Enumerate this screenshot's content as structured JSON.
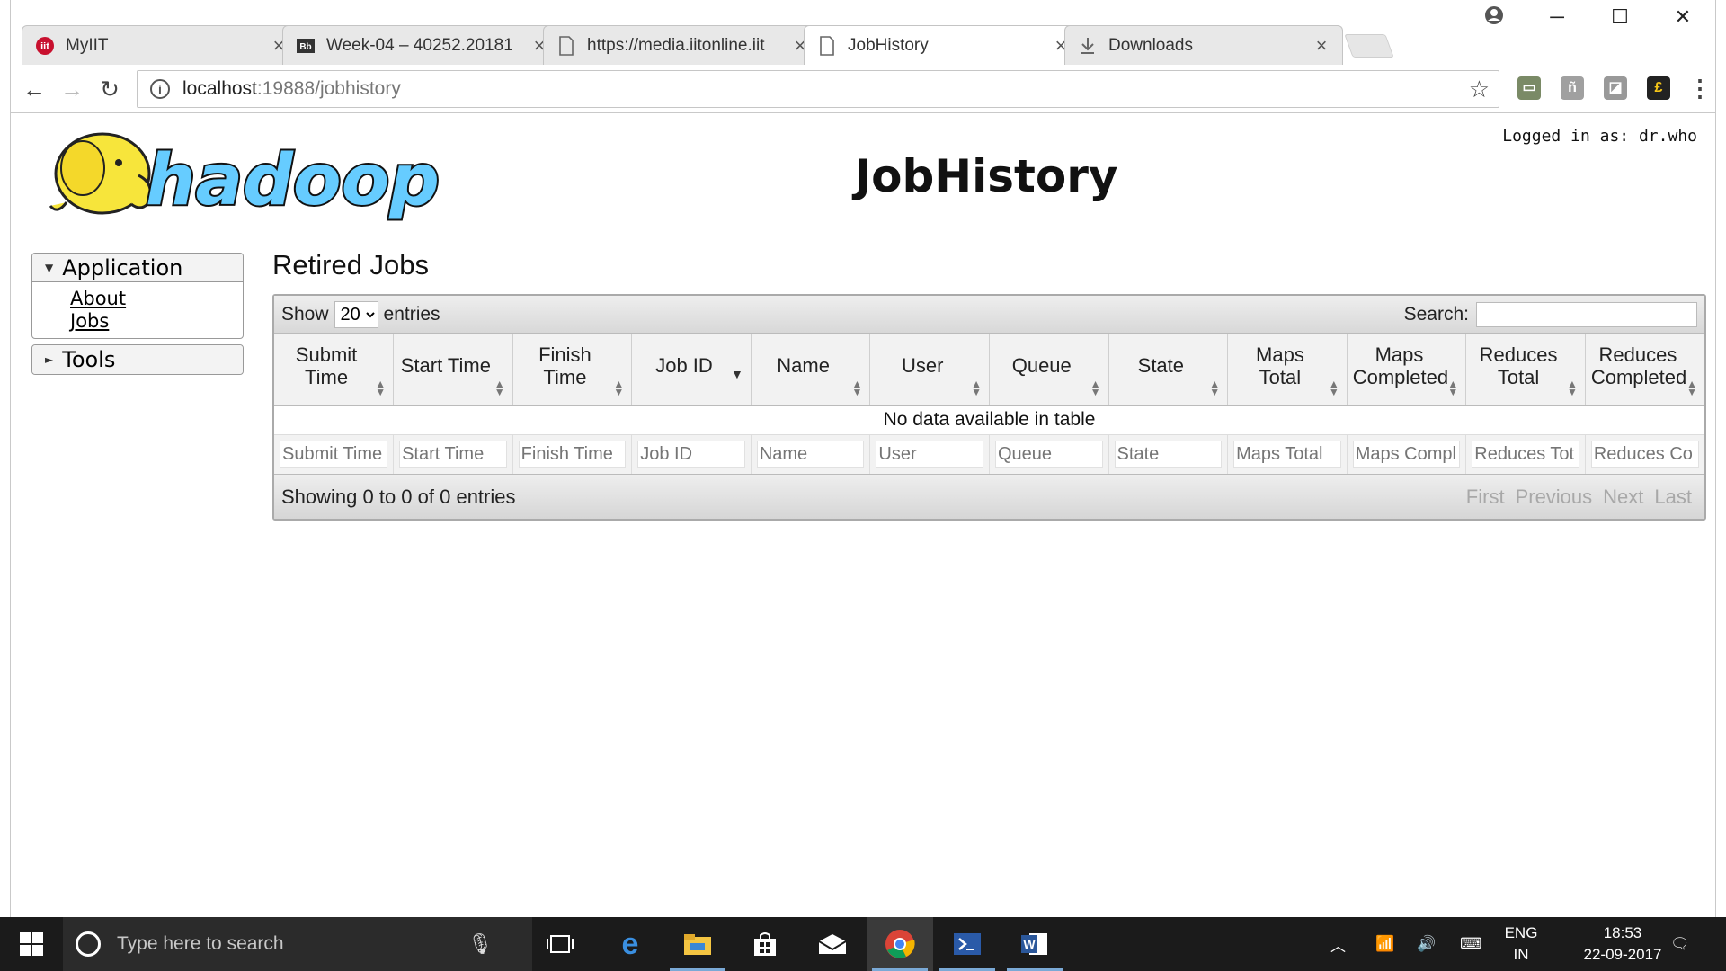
{
  "browser": {
    "tabs": [
      {
        "label": "MyIIT",
        "icon": "iit-favicon"
      },
      {
        "label": "Week-04 – 40252.20181",
        "icon": "blackboard-favicon"
      },
      {
        "label": "https://media.iitonline.iit",
        "icon": "page-icon"
      },
      {
        "label": "JobHistory",
        "icon": "page-icon"
      },
      {
        "label": "Downloads",
        "icon": "download-icon"
      }
    ],
    "active_tab": "JobHistory",
    "url_host": "localhost",
    "url_path": ":19888/jobhistory"
  },
  "page": {
    "logged_in": "Logged in as: dr.who",
    "title": "JobHistory",
    "logo_text": "hadoop"
  },
  "nav": {
    "application_label": "Application",
    "links": [
      "About",
      "Jobs"
    ],
    "tools_label": "Tools"
  },
  "content": {
    "section_title": "Retired Jobs",
    "show_label": "Show",
    "entries_label": "entries",
    "page_length": "20",
    "search_label": "Search:",
    "columns": [
      "Submit Time",
      "Start Time",
      "Finish Time",
      "Job ID",
      "Name",
      "User",
      "Queue",
      "State",
      "Maps Total",
      "Maps Completed",
      "Reduces Total",
      "Reduces Completed"
    ],
    "empty_message": "No data available in table",
    "filter_placeholders": [
      "Submit Time",
      "Start Time",
      "Finish Time",
      "Job ID",
      "Name",
      "User",
      "Queue",
      "State",
      "Maps Total",
      "Maps Compl",
      "Reduces Tot",
      "Reduces Co"
    ],
    "info": "Showing 0 to 0 of 0 entries",
    "pagination": {
      "first": "First",
      "previous": "Previous",
      "next": "Next",
      "last": "Last"
    }
  },
  "taskbar": {
    "search_placeholder": "Type here to search",
    "lang_line1": "ENG",
    "lang_line2": "IN",
    "time": "18:53",
    "date": "22-09-2017"
  },
  "colors": {
    "taskbar": "#1b1b1b",
    "header_gradient_top": "#eeeeee",
    "header_gradient_bottom": "#d8d8d8",
    "hadoop_yellow": "#f7e53b",
    "hadoop_blue": "#66ccff"
  }
}
